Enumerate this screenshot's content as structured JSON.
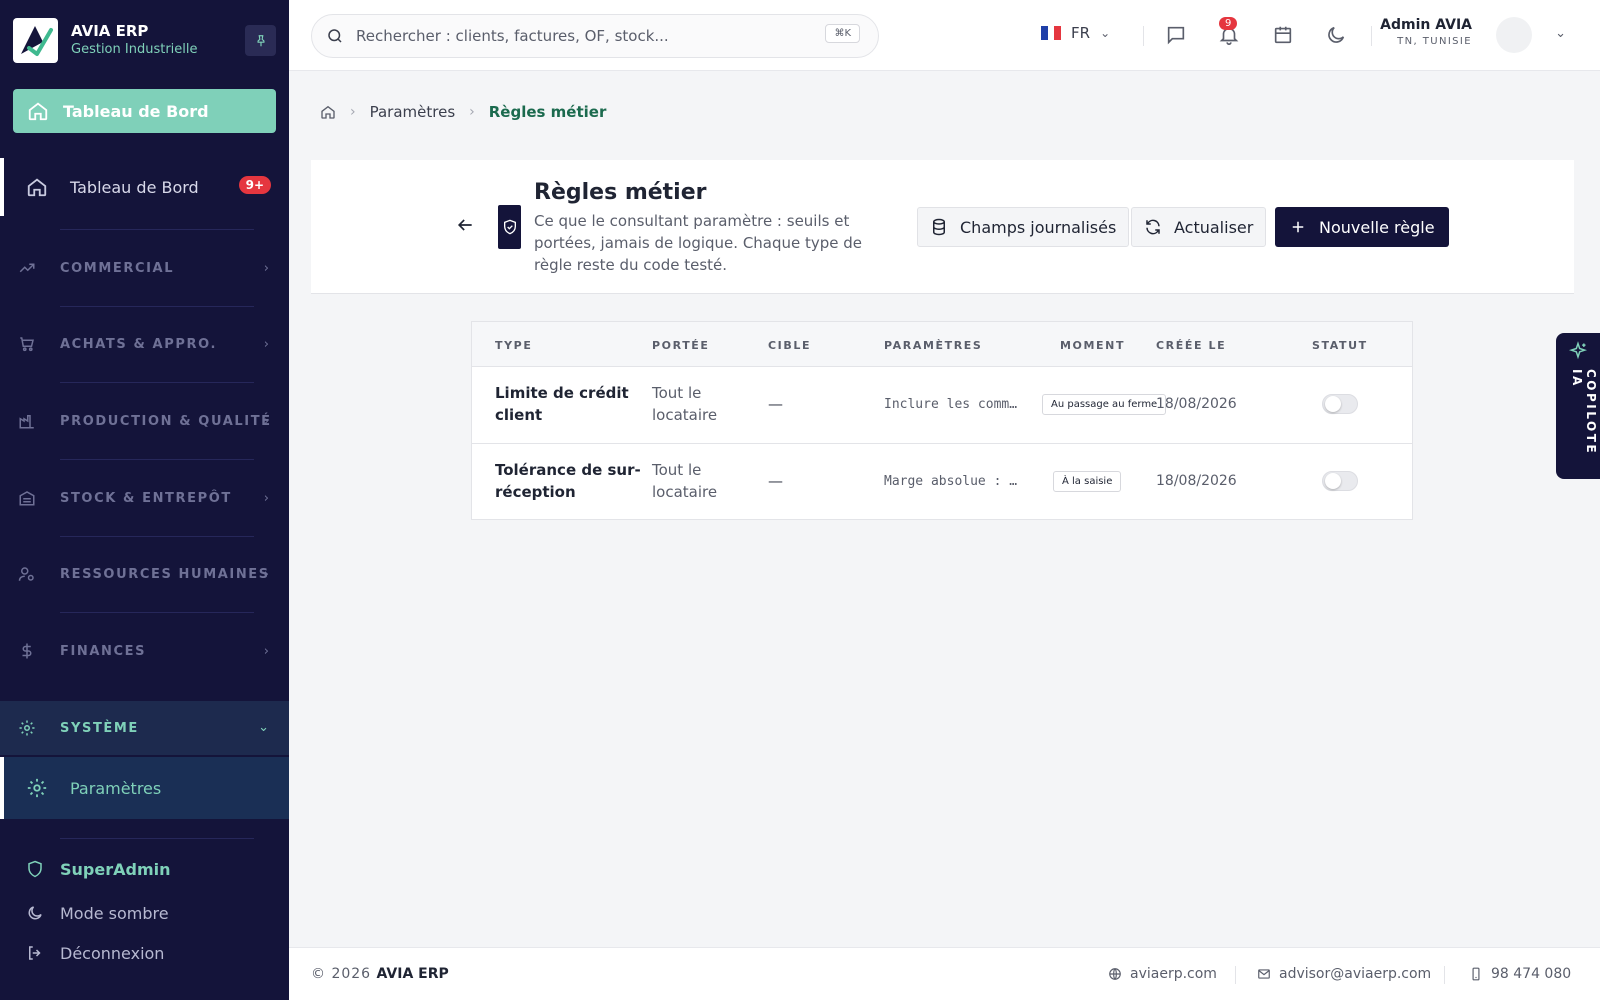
{
  "sidebar": {
    "brand_name": "AVIA ERP",
    "brand_sub": "Gestion Industrielle",
    "top_item": "Tableau de Bord",
    "dashboard_item": "Tableau de Bord",
    "dashboard_badge": "9+",
    "sections": [
      {
        "label": "COMMERCIAL",
        "icon": "trending-up-icon"
      },
      {
        "label": "ACHATS & APPRO.",
        "icon": "cart-icon"
      },
      {
        "label": "PRODUCTION & QUALITÉ",
        "icon": "factory-icon"
      },
      {
        "label": "STOCK & ENTREPÔT",
        "icon": "warehouse-icon"
      },
      {
        "label": "RESSOURCES HUMAINES",
        "icon": "user-gear-icon"
      },
      {
        "label": "FINANCES",
        "icon": "dollar-icon"
      },
      {
        "label": "SYSTÈME",
        "icon": "gear-icon"
      }
    ],
    "active_sub_item": "Paramètres",
    "super_admin": "SuperAdmin",
    "dark_mode": "Mode sombre",
    "logout": "Déconnexion"
  },
  "topbar": {
    "search_placeholder": "Rechercher : clients, factures, OF, stock...",
    "search_shortcut": "⌘K",
    "language": "FR",
    "notif_count": "9",
    "user_name": "Admin AVIA",
    "user_location": "TN, TUNISIE"
  },
  "breadcrumb": {
    "parent": "Paramètres",
    "current": "Règles métier"
  },
  "page": {
    "title": "Règles métier",
    "description": "Ce que le consultant paramètre : seuils et portées, jamais de logique. Chaque type de règle reste du code testé.",
    "btn_logged_fields": "Champs journalisés",
    "btn_refresh": "Actualiser",
    "btn_new_rule": "Nouvelle règle"
  },
  "table": {
    "headers": [
      "TYPE",
      "PORTÉE",
      "CIBLE",
      "PARAMÈTRES",
      "MOMENT",
      "CRÉÉE LE",
      "STATUT"
    ],
    "rows": [
      {
        "type": "Limite de crédit client",
        "scope": "Tout le locataire",
        "target": "—",
        "params": "Inclure les comm…",
        "moment": "Au passage au ferme",
        "created": "18/08/2026",
        "status_on": false
      },
      {
        "type": "Tolérance de sur-réception",
        "scope": "Tout le locataire",
        "target": "—",
        "params": "Marge absolue : …",
        "moment": "À la saisie",
        "created": "18/08/2026",
        "status_on": false
      }
    ]
  },
  "copilot": {
    "label": "COPILOTE IA"
  },
  "footer": {
    "year": "© 2026",
    "brand": "AVIA ERP",
    "website": "aviaerp.com",
    "email": "advisor@aviaerp.com",
    "phone": "98 474 080"
  },
  "colors": {
    "sidebar_bg": "#14143a",
    "accent_mint": "#7fd0b9",
    "accent_green_text": "#1b6a4e",
    "badge_red": "#e5363f",
    "primary_dark": "#14143a"
  }
}
